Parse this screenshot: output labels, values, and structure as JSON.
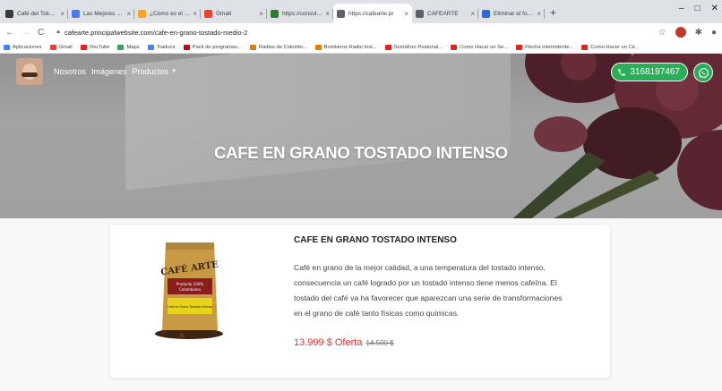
{
  "browser": {
    "tabs": [
      {
        "title": "Café del Tolima, Co",
        "color": "#3a3a3a"
      },
      {
        "title": "Las Mejores Fotogr",
        "color": "#4b7bec"
      },
      {
        "title": "¿Cómo es el proce",
        "color": "#f5a623"
      },
      {
        "title": "Gmail",
        "color": "#ea4335"
      },
      {
        "title": "https://consola.lau",
        "color": "#2e7d32"
      },
      {
        "title": "https://cafearte.pr",
        "color": "#5f6368"
      },
      {
        "title": "CAFEARTE",
        "color": "#5f6368"
      },
      {
        "title": "Eliminar el fondo",
        "color": "#3367d6"
      }
    ],
    "new_tab": "+",
    "window_controls": [
      "–",
      "□",
      "✕"
    ],
    "url": "cafearte.principalwebsite.com/cafe-en-grano-tostado-medio-2",
    "bookmarks": [
      {
        "label": "Aplicaciones",
        "color": "#4285f4"
      },
      {
        "label": "Gmail",
        "color": "#ea4335"
      },
      {
        "label": "YouTube",
        "color": "#e62117"
      },
      {
        "label": "Maps",
        "color": "#34a853"
      },
      {
        "label": "Traducir",
        "color": "#4285f4"
      },
      {
        "label": "Pack de programas...",
        "color": "#c00"
      },
      {
        "label": "Radios de Colombi...",
        "color": "#e07b00"
      },
      {
        "label": "Bomberos Radio Inst...",
        "color": "#e07b00"
      },
      {
        "label": "Semáforo Peatonal...",
        "color": "#e62117"
      },
      {
        "label": "Como Hacer un Se...",
        "color": "#e62117"
      },
      {
        "label": "Flecha intermitente...",
        "color": "#e62117"
      },
      {
        "label": "Como Hacer un Cir...",
        "color": "#e62117"
      }
    ]
  },
  "site": {
    "nav": {
      "links": [
        "Nosotros",
        "Imágenes",
        "Productos"
      ],
      "products_caret": "▼",
      "phone": "3168197467"
    },
    "hero_title": "CAFE EN GRANO TOSTADO INTENSO",
    "product": {
      "title": "CAFE EN GRANO TOSTADO INTENSO",
      "description": "Café en grano de la mejor calidad, a una temperatura del tostado intenso, consecuencia un café logrado por un tostado intenso tiene menos cafeína. El tostado del café va ha favorecer que aparezcan una serie de transformaciones en el grano de café tanto físicas como químicas.",
      "price": "13.999 $ Oferta",
      "old_price": "14.500 $",
      "bag_brand": "CAFÉ ARTE",
      "bag_line1": "Producto 100%",
      "bag_line2": "Colombiano",
      "bag_label": "Café en Grano Tostado Intenso"
    },
    "colors": {
      "accent_green": "#2bae58",
      "price_red": "#e0332e"
    }
  }
}
